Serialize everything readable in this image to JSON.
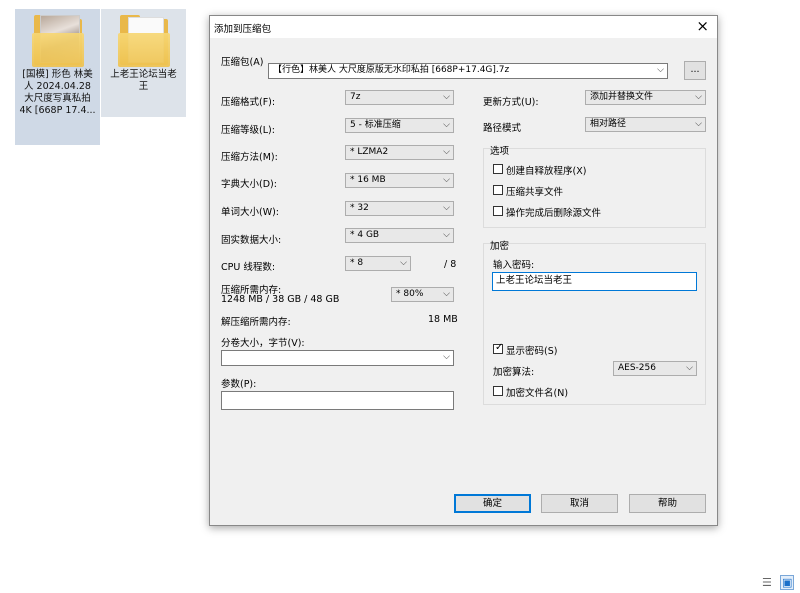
{
  "desktop": {
    "icons": [
      {
        "label": "[国模] 形色 林美\n人 2024.04.28\n大尺度写真私拍\n4K [668P 17.4..."
      },
      {
        "label": "上老王论坛当老\n王"
      }
    ]
  },
  "dialog": {
    "title": "添加到压缩包",
    "close_icon": "×",
    "archive_label": "压缩包(A)",
    "archive_value": "【行色】林美人 大尺度原版无水印私拍 [668P+17.4G].7z",
    "browse_label": "...",
    "format_label": "压缩格式(F):",
    "format_value": "7z",
    "level_label": "压缩等级(L):",
    "level_value": "5 - 标准压缩",
    "method_label": "压缩方法(M):",
    "method_value": "* LZMA2",
    "dict_label": "字典大小(D):",
    "dict_value": "* 16 MB",
    "word_label": "单词大小(W):",
    "word_value": "* 32",
    "solid_label": "固实数据大小:",
    "solid_value": "* 4 GB",
    "threads_label": "CPU 线程数:",
    "threads_value": "* 8",
    "threads_max": "/ 8",
    "mem_comp_label": "压缩所需内存:",
    "mem_comp_value": "1248 MB / 38 GB / 48 GB",
    "mem_percent": "* 80%",
    "mem_decomp_label": "解压缩所需内存:",
    "mem_decomp_value": "18 MB",
    "split_label": "分卷大小，字节(V):",
    "split_value": "",
    "params_label": "参数(P):",
    "params_value": "",
    "update_label": "更新方式(U):",
    "update_value": "添加并替换文件",
    "path_label": "路径模式",
    "path_value": "相对路径",
    "options_title": "选项",
    "opt_sfx": "创建自释放程序(X)",
    "opt_shared": "压缩共享文件",
    "opt_delete": "操作完成后删除源文件",
    "enc_title": "加密",
    "password_label": "输入密码:",
    "password_value": "上老王论坛当老王",
    "show_password": "显示密码(S)",
    "enc_method_label": "加密算法:",
    "enc_method_value": "AES-256",
    "enc_names": "加密文件名(N)",
    "ok": "确定",
    "cancel": "取消",
    "help": "帮助"
  },
  "taskbar": {
    "details_view_icon": "☰",
    "large_icons_view_icon": "▣"
  }
}
